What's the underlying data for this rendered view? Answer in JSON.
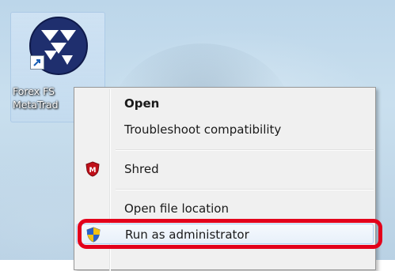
{
  "desktop": {
    "shortcut": {
      "label_line1": "Forex FS",
      "label_line2": "MetaTrad",
      "icon": "forex-app-icon",
      "overlay_icon": "shortcut-arrow-icon"
    }
  },
  "context_menu": {
    "items": [
      {
        "label": "Open",
        "bold": true,
        "icon": null
      },
      {
        "label": "Troubleshoot compatibility",
        "bold": false,
        "icon": null
      },
      {
        "label": "Shred",
        "bold": false,
        "icon": "mcafee-shield-icon"
      },
      {
        "label": "Open file location",
        "bold": false,
        "icon": null
      },
      {
        "label": "Run as administrator",
        "bold": false,
        "icon": "uac-shield-icon",
        "highlighted": true
      }
    ]
  },
  "annotation": {
    "color": "#e3001b",
    "target": "Run as administrator"
  }
}
